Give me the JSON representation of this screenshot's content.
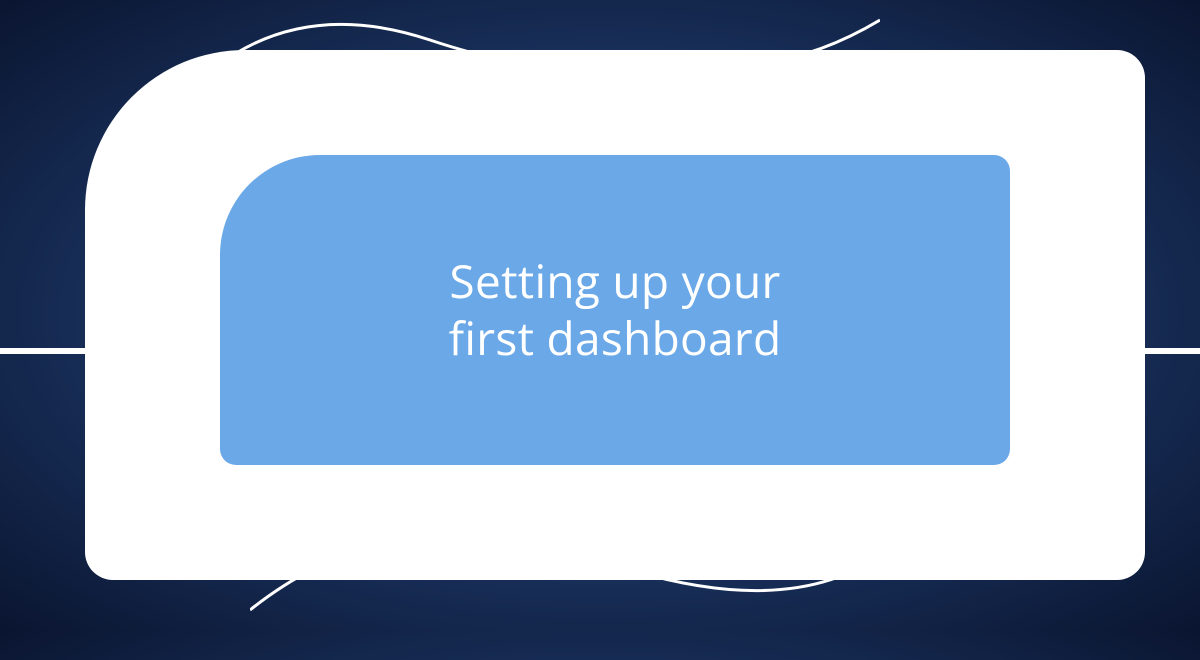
{
  "hero": {
    "title_line1": "Setting up your",
    "title_line2": "first dashboard"
  },
  "colors": {
    "inner_panel": "#6aa8e8",
    "outer_panel": "#ffffff",
    "background_center": "#4a7bc4",
    "background_edge": "#0a1530"
  }
}
